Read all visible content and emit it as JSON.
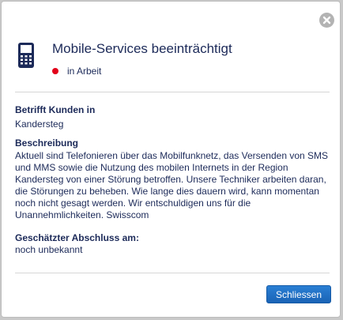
{
  "dialog": {
    "title": "Mobile-Services beeinträchtigt",
    "status": {
      "label": "in Arbeit",
      "color": "#e2001a"
    },
    "icon": "mobile-phone-icon",
    "close_icon": "close-icon",
    "affected": {
      "label": "Betrifft Kunden in",
      "value": "Kandersteg"
    },
    "description": {
      "label": "Beschreibung",
      "text": "Aktuell sind Telefonieren über das Mobilfunknetz, das Versenden von SMS und MMS sowie die Nutzung des mobilen Internets in der Region Kandersteg von einer Störung betroffen. Unsere Techniker arbeiten daran, die Störungen zu beheben. Wie lange dies dauern wird, kann momentan noch nicht gesagt werden. Wir entschuldigen uns für die Unannehmlichkeiten. Swisscom"
    },
    "estimate": {
      "label": "Geschätzter Abschluss am:",
      "value": "noch unbekannt"
    },
    "close_button_label": "Schliessen",
    "accent_color": "#1a63b6",
    "text_color": "#1c2a59"
  }
}
